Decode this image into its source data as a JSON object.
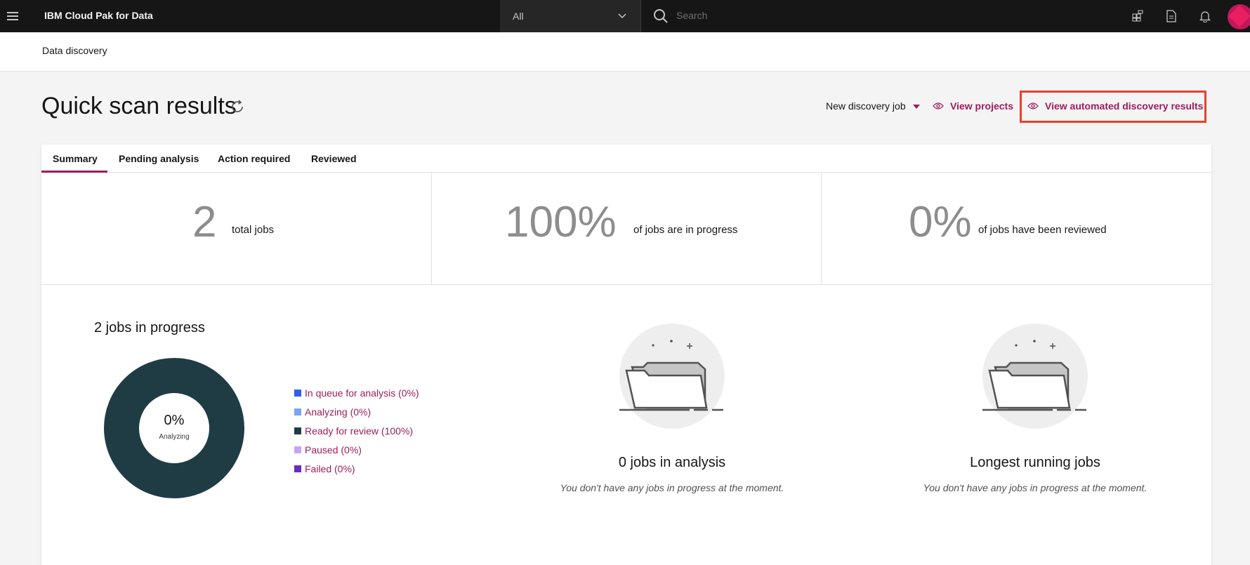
{
  "header": {
    "brand": "IBM Cloud Pak for Data",
    "scope_value": "All",
    "search_placeholder": "Search"
  },
  "breadcrumb": {
    "current": "Data discovery"
  },
  "page": {
    "title": "Quick scan results",
    "new_job_label": "New discovery job",
    "view_projects_label": "View projects",
    "view_automated_label": "View automated discovery results"
  },
  "tabs": [
    {
      "label": "Summary",
      "selected": true
    },
    {
      "label": "Pending analysis",
      "selected": false
    },
    {
      "label": "Action required",
      "selected": false
    },
    {
      "label": "Reviewed",
      "selected": false
    }
  ],
  "stats": [
    {
      "value": "2",
      "text": "total jobs"
    },
    {
      "value": "100%",
      "text": "of jobs are in progress"
    },
    {
      "value": "0%",
      "text": "of jobs have been reviewed"
    }
  ],
  "progress": {
    "title": "2 jobs in progress",
    "donut_value": "0%",
    "donut_label": "Analyzing",
    "legend": [
      {
        "label": "In queue for analysis (0%)",
        "color": "#2d5ff0",
        "percent": 0
      },
      {
        "label": "Analyzing (0%)",
        "color": "#7ba4f4",
        "percent": 0
      },
      {
        "label": "Ready for review (100%)",
        "color": "#1f3c45",
        "percent": 100
      },
      {
        "label": "Paused (0%)",
        "color": "#c4a6ef",
        "percent": 0
      },
      {
        "label": "Failed (0%)",
        "color": "#6929c4",
        "percent": 0
      }
    ]
  },
  "analysis_panel": {
    "title": "0 jobs in analysis",
    "message": "You don't have any jobs in progress at the moment."
  },
  "longest_panel": {
    "title": "Longest running jobs",
    "message": "You don't have any jobs in progress at the moment."
  },
  "colors": {
    "accent": "#9d1d5a",
    "highlight_border": "#e8412a",
    "header_bg": "#161616"
  }
}
